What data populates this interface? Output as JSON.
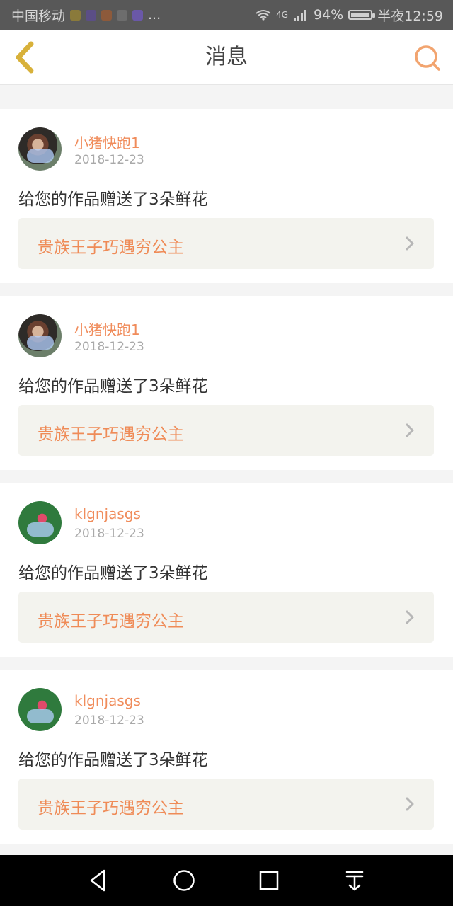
{
  "status_bar": {
    "carrier": "中国移动",
    "more": "...",
    "network": "4G",
    "battery": "94%",
    "battery_fraction": 0.94,
    "time": "半夜12:59"
  },
  "header": {
    "title": "消息"
  },
  "messages": [
    {
      "username": "小猪快跑1",
      "date": "2018-12-23",
      "text": "给您的作品赠送了3朵鲜花",
      "work_title": "贵族王子巧遇穷公主"
    },
    {
      "username": "小猪快跑1",
      "date": "2018-12-23",
      "text": "给您的作品赠送了3朵鲜花",
      "work_title": "贵族王子巧遇穷公主"
    },
    {
      "username": "klgnjasgs",
      "date": "2018-12-23",
      "text": "给您的作品赠送了3朵鲜花",
      "work_title": "贵族王子巧遇穷公主"
    },
    {
      "username": "klgnjasgs",
      "date": "2018-12-23",
      "text": "给您的作品赠送了3朵鲜花",
      "work_title": "贵族王子巧遇穷公主"
    }
  ],
  "icons": {
    "back": "back-arrow-icon",
    "search": "search-icon",
    "chevron": "chevron-right-icon"
  },
  "colors": {
    "accent": "#f08c5b",
    "back_icon": "#d8b13a",
    "search_icon": "#f2a46f",
    "card_bg": "#ffffff",
    "page_bg": "#f4f4f4",
    "link_box_bg": "#f3f3ee",
    "date": "#a9a9a9"
  }
}
